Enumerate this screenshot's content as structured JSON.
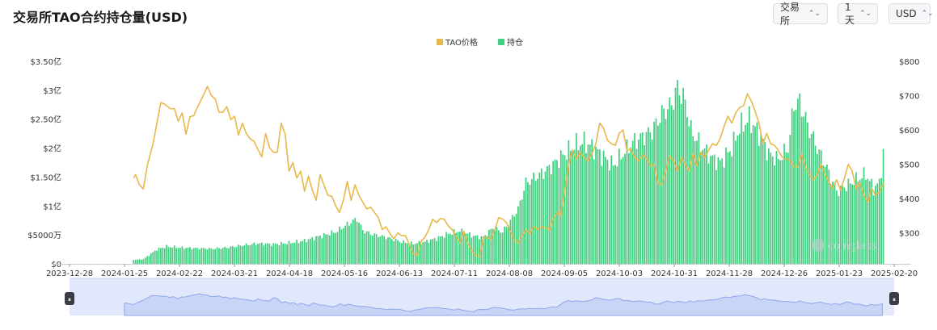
{
  "title": "交易所TAO合约持仓量(USD)",
  "controls": {
    "exchange": "交易所",
    "interval": "1天",
    "currency": "USD"
  },
  "colors": {
    "price": "#e8b84a",
    "oi": "#3fcf7f",
    "navigator_fill": "#dfe6fb",
    "navigator_line": "#8fa6ea"
  },
  "chart_data": {
    "type": "bar+line",
    "legend": [
      "TAO价格",
      "持仓"
    ],
    "legend_position": "top-center",
    "y_left": {
      "ticks": [
        "$0",
        "$5000万",
        "$1亿",
        "$1.50亿",
        "$2亿",
        "$2.50亿",
        "$3亿",
        "$3.50亿"
      ],
      "range": [
        0,
        350000000
      ]
    },
    "y_right": {
      "ticks": [
        "$300",
        "$400",
        "$500",
        "$600",
        "$700",
        "$800"
      ],
      "range": [
        210,
        800
      ]
    },
    "x_ticks": [
      "2023-12-28",
      "2024-01-25",
      "2024-02-22",
      "2024-03-21",
      "2024-04-18",
      "2024-05-16",
      "2024-06-13",
      "2024-07-11",
      "2024-08-08",
      "2024-09-05",
      "2024-10-03",
      "2024-10-31",
      "2024-11-28",
      "2024-12-26",
      "2025-01-23",
      "2025-02-20"
    ],
    "x_range_days": [
      0,
      420
    ],
    "series": [
      {
        "name": "持仓",
        "kind": "bar",
        "axis": "left",
        "points": [
          [
            28,
            7000000
          ],
          [
            33,
            8000000
          ],
          [
            36,
            15000000
          ],
          [
            40,
            25000000
          ],
          [
            45,
            30000000
          ],
          [
            52,
            28000000
          ],
          [
            60,
            27000000
          ],
          [
            68,
            26000000
          ],
          [
            76,
            28000000
          ],
          [
            84,
            32000000
          ],
          [
            92,
            35000000
          ],
          [
            100,
            34000000
          ],
          [
            108,
            36000000
          ],
          [
            116,
            40000000
          ],
          [
            124,
            48000000
          ],
          [
            132,
            55000000
          ],
          [
            138,
            68000000
          ],
          [
            143,
            78000000
          ],
          [
            146,
            58000000
          ],
          [
            150,
            52000000
          ],
          [
            158,
            46000000
          ],
          [
            166,
            38000000
          ],
          [
            172,
            35000000
          ],
          [
            178,
            38000000
          ],
          [
            184,
            44000000
          ],
          [
            190,
            52000000
          ],
          [
            196,
            57000000
          ],
          [
            203,
            48000000
          ],
          [
            208,
            46000000
          ],
          [
            213,
            62000000
          ],
          [
            218,
            55000000
          ],
          [
            222,
            75000000
          ],
          [
            226,
            95000000
          ],
          [
            230,
            140000000
          ],
          [
            235,
            150000000
          ],
          [
            240,
            160000000
          ],
          [
            245,
            175000000
          ],
          [
            250,
            190000000
          ],
          [
            255,
            205000000
          ],
          [
            260,
            210000000
          ],
          [
            265,
            200000000
          ],
          [
            270,
            185000000
          ],
          [
            275,
            170000000
          ],
          [
            280,
            190000000
          ],
          [
            285,
            210000000
          ],
          [
            290,
            220000000
          ],
          [
            295,
            230000000
          ],
          [
            300,
            260000000
          ],
          [
            305,
            275000000
          ],
          [
            308,
            305000000
          ],
          [
            312,
            280000000
          ],
          [
            315,
            230000000
          ],
          [
            320,
            205000000
          ],
          [
            325,
            185000000
          ],
          [
            330,
            175000000
          ],
          [
            336,
            200000000
          ],
          [
            340,
            235000000
          ],
          [
            345,
            250000000
          ],
          [
            350,
            225000000
          ],
          [
            355,
            190000000
          ],
          [
            360,
            180000000
          ],
          [
            365,
            200000000
          ],
          [
            368,
            275000000
          ],
          [
            371,
            280000000
          ],
          [
            375,
            240000000
          ],
          [
            380,
            200000000
          ],
          [
            385,
            165000000
          ],
          [
            390,
            125000000
          ],
          [
            395,
            135000000
          ],
          [
            400,
            145000000
          ],
          [
            405,
            155000000
          ],
          [
            409,
            130000000
          ],
          [
            412,
            140000000
          ],
          [
            414,
            190000000
          ]
        ]
      },
      {
        "name": "TAO价格",
        "kind": "line",
        "axis": "right",
        "points": [
          [
            28,
            460
          ],
          [
            29,
            470
          ],
          [
            31,
            440
          ],
          [
            33,
            428
          ],
          [
            35,
            495
          ],
          [
            38,
            560
          ],
          [
            40,
            620
          ],
          [
            42,
            680
          ],
          [
            44,
            675
          ],
          [
            47,
            662
          ],
          [
            49,
            662
          ],
          [
            51,
            625
          ],
          [
            53,
            650
          ],
          [
            55,
            588
          ],
          [
            57,
            638
          ],
          [
            59,
            642
          ],
          [
            61,
            668
          ],
          [
            63,
            690
          ],
          [
            65,
            715
          ],
          [
            66,
            727
          ],
          [
            68,
            700
          ],
          [
            70,
            690
          ],
          [
            72,
            652
          ],
          [
            74,
            652
          ],
          [
            76,
            668
          ],
          [
            78,
            630
          ],
          [
            80,
            640
          ],
          [
            82,
            585
          ],
          [
            84,
            620
          ],
          [
            86,
            590
          ],
          [
            88,
            574
          ],
          [
            90,
            567
          ],
          [
            92,
            543
          ],
          [
            94,
            522
          ],
          [
            96,
            590
          ],
          [
            98,
            548
          ],
          [
            100,
            535
          ],
          [
            102,
            535
          ],
          [
            104,
            620
          ],
          [
            106,
            588
          ],
          [
            108,
            480
          ],
          [
            110,
            505
          ],
          [
            112,
            460
          ],
          [
            114,
            480
          ],
          [
            116,
            422
          ],
          [
            118,
            465
          ],
          [
            120,
            425
          ],
          [
            122,
            395
          ],
          [
            124,
            470
          ],
          [
            126,
            440
          ],
          [
            128,
            410
          ],
          [
            130,
            407
          ],
          [
            132,
            380
          ],
          [
            134,
            360
          ],
          [
            136,
            395
          ],
          [
            138,
            450
          ],
          [
            140,
            395
          ],
          [
            142,
            440
          ],
          [
            144,
            410
          ],
          [
            146,
            390
          ],
          [
            148,
            370
          ],
          [
            150,
            375
          ],
          [
            152,
            360
          ],
          [
            154,
            345
          ],
          [
            156,
            310
          ],
          [
            158,
            318
          ],
          [
            160,
            298
          ],
          [
            162,
            283
          ],
          [
            164,
            300
          ],
          [
            166,
            292
          ],
          [
            168,
            292
          ],
          [
            170,
            265
          ],
          [
            172,
            240
          ],
          [
            174,
            235
          ],
          [
            176,
            275
          ],
          [
            178,
            288
          ],
          [
            180,
            310
          ],
          [
            182,
            340
          ],
          [
            184,
            330
          ],
          [
            186,
            342
          ],
          [
            188,
            340
          ],
          [
            190,
            320
          ],
          [
            192,
            310
          ],
          [
            194,
            290
          ],
          [
            196,
            270
          ],
          [
            198,
            305
          ],
          [
            200,
            270
          ],
          [
            202,
            250
          ],
          [
            204,
            235
          ],
          [
            206,
            230
          ],
          [
            208,
            285
          ],
          [
            210,
            290
          ],
          [
            212,
            280
          ],
          [
            214,
            310
          ],
          [
            216,
            345
          ],
          [
            218,
            340
          ],
          [
            220,
            330
          ],
          [
            222,
            305
          ],
          [
            224,
            280
          ],
          [
            226,
            270
          ],
          [
            228,
            290
          ],
          [
            230,
            310
          ],
          [
            232,
            298
          ],
          [
            234,
            320
          ],
          [
            236,
            310
          ],
          [
            238,
            318
          ],
          [
            240,
            315
          ],
          [
            242,
            308
          ],
          [
            244,
            340
          ],
          [
            246,
            360
          ],
          [
            248,
            350
          ],
          [
            250,
            420
          ],
          [
            252,
            500
          ],
          [
            254,
            540
          ],
          [
            256,
            515
          ],
          [
            258,
            535
          ],
          [
            260,
            520
          ],
          [
            262,
            510
          ],
          [
            264,
            530
          ],
          [
            266,
            560
          ],
          [
            268,
            620
          ],
          [
            270,
            605
          ],
          [
            272,
            570
          ],
          [
            274,
            560
          ],
          [
            276,
            555
          ],
          [
            278,
            590
          ],
          [
            280,
            600
          ],
          [
            282,
            540
          ],
          [
            284,
            545
          ],
          [
            286,
            520
          ],
          [
            288,
            510
          ],
          [
            290,
            528
          ],
          [
            292,
            517
          ],
          [
            294,
            495
          ],
          [
            296,
            500
          ],
          [
            298,
            445
          ],
          [
            300,
            440
          ],
          [
            302,
            480
          ],
          [
            304,
            525
          ],
          [
            306,
            510
          ],
          [
            308,
            480
          ],
          [
            310,
            520
          ],
          [
            312,
            500
          ],
          [
            314,
            480
          ],
          [
            316,
            530
          ],
          [
            318,
            495
          ],
          [
            320,
            535
          ],
          [
            322,
            520
          ],
          [
            324,
            540
          ],
          [
            326,
            560
          ],
          [
            328,
            555
          ],
          [
            330,
            575
          ],
          [
            332,
            610
          ],
          [
            334,
            640
          ],
          [
            336,
            620
          ],
          [
            338,
            650
          ],
          [
            340,
            665
          ],
          [
            342,
            670
          ],
          [
            344,
            705
          ],
          [
            346,
            685
          ],
          [
            348,
            655
          ],
          [
            350,
            620
          ],
          [
            352,
            560
          ],
          [
            354,
            590
          ],
          [
            356,
            560
          ],
          [
            358,
            555
          ],
          [
            360,
            540
          ],
          [
            362,
            520
          ],
          [
            364,
            515
          ],
          [
            366,
            510
          ],
          [
            368,
            495
          ],
          [
            370,
            492
          ],
          [
            372,
            530
          ],
          [
            374,
            490
          ],
          [
            376,
            470
          ],
          [
            378,
            455
          ],
          [
            380,
            470
          ],
          [
            382,
            500
          ],
          [
            384,
            470
          ],
          [
            386,
            448
          ],
          [
            388,
            430
          ],
          [
            390,
            455
          ],
          [
            392,
            425
          ],
          [
            394,
            460
          ],
          [
            396,
            500
          ],
          [
            398,
            480
          ],
          [
            400,
            430
          ],
          [
            402,
            445
          ],
          [
            404,
            410
          ],
          [
            406,
            390
          ],
          [
            408,
            430
          ],
          [
            410,
            410
          ],
          [
            412,
            420
          ],
          [
            414,
            445
          ]
        ]
      }
    ]
  },
  "watermark": "coinglass",
  "navigator": {
    "handle_left": "⏸",
    "handle_right": "⏸"
  }
}
